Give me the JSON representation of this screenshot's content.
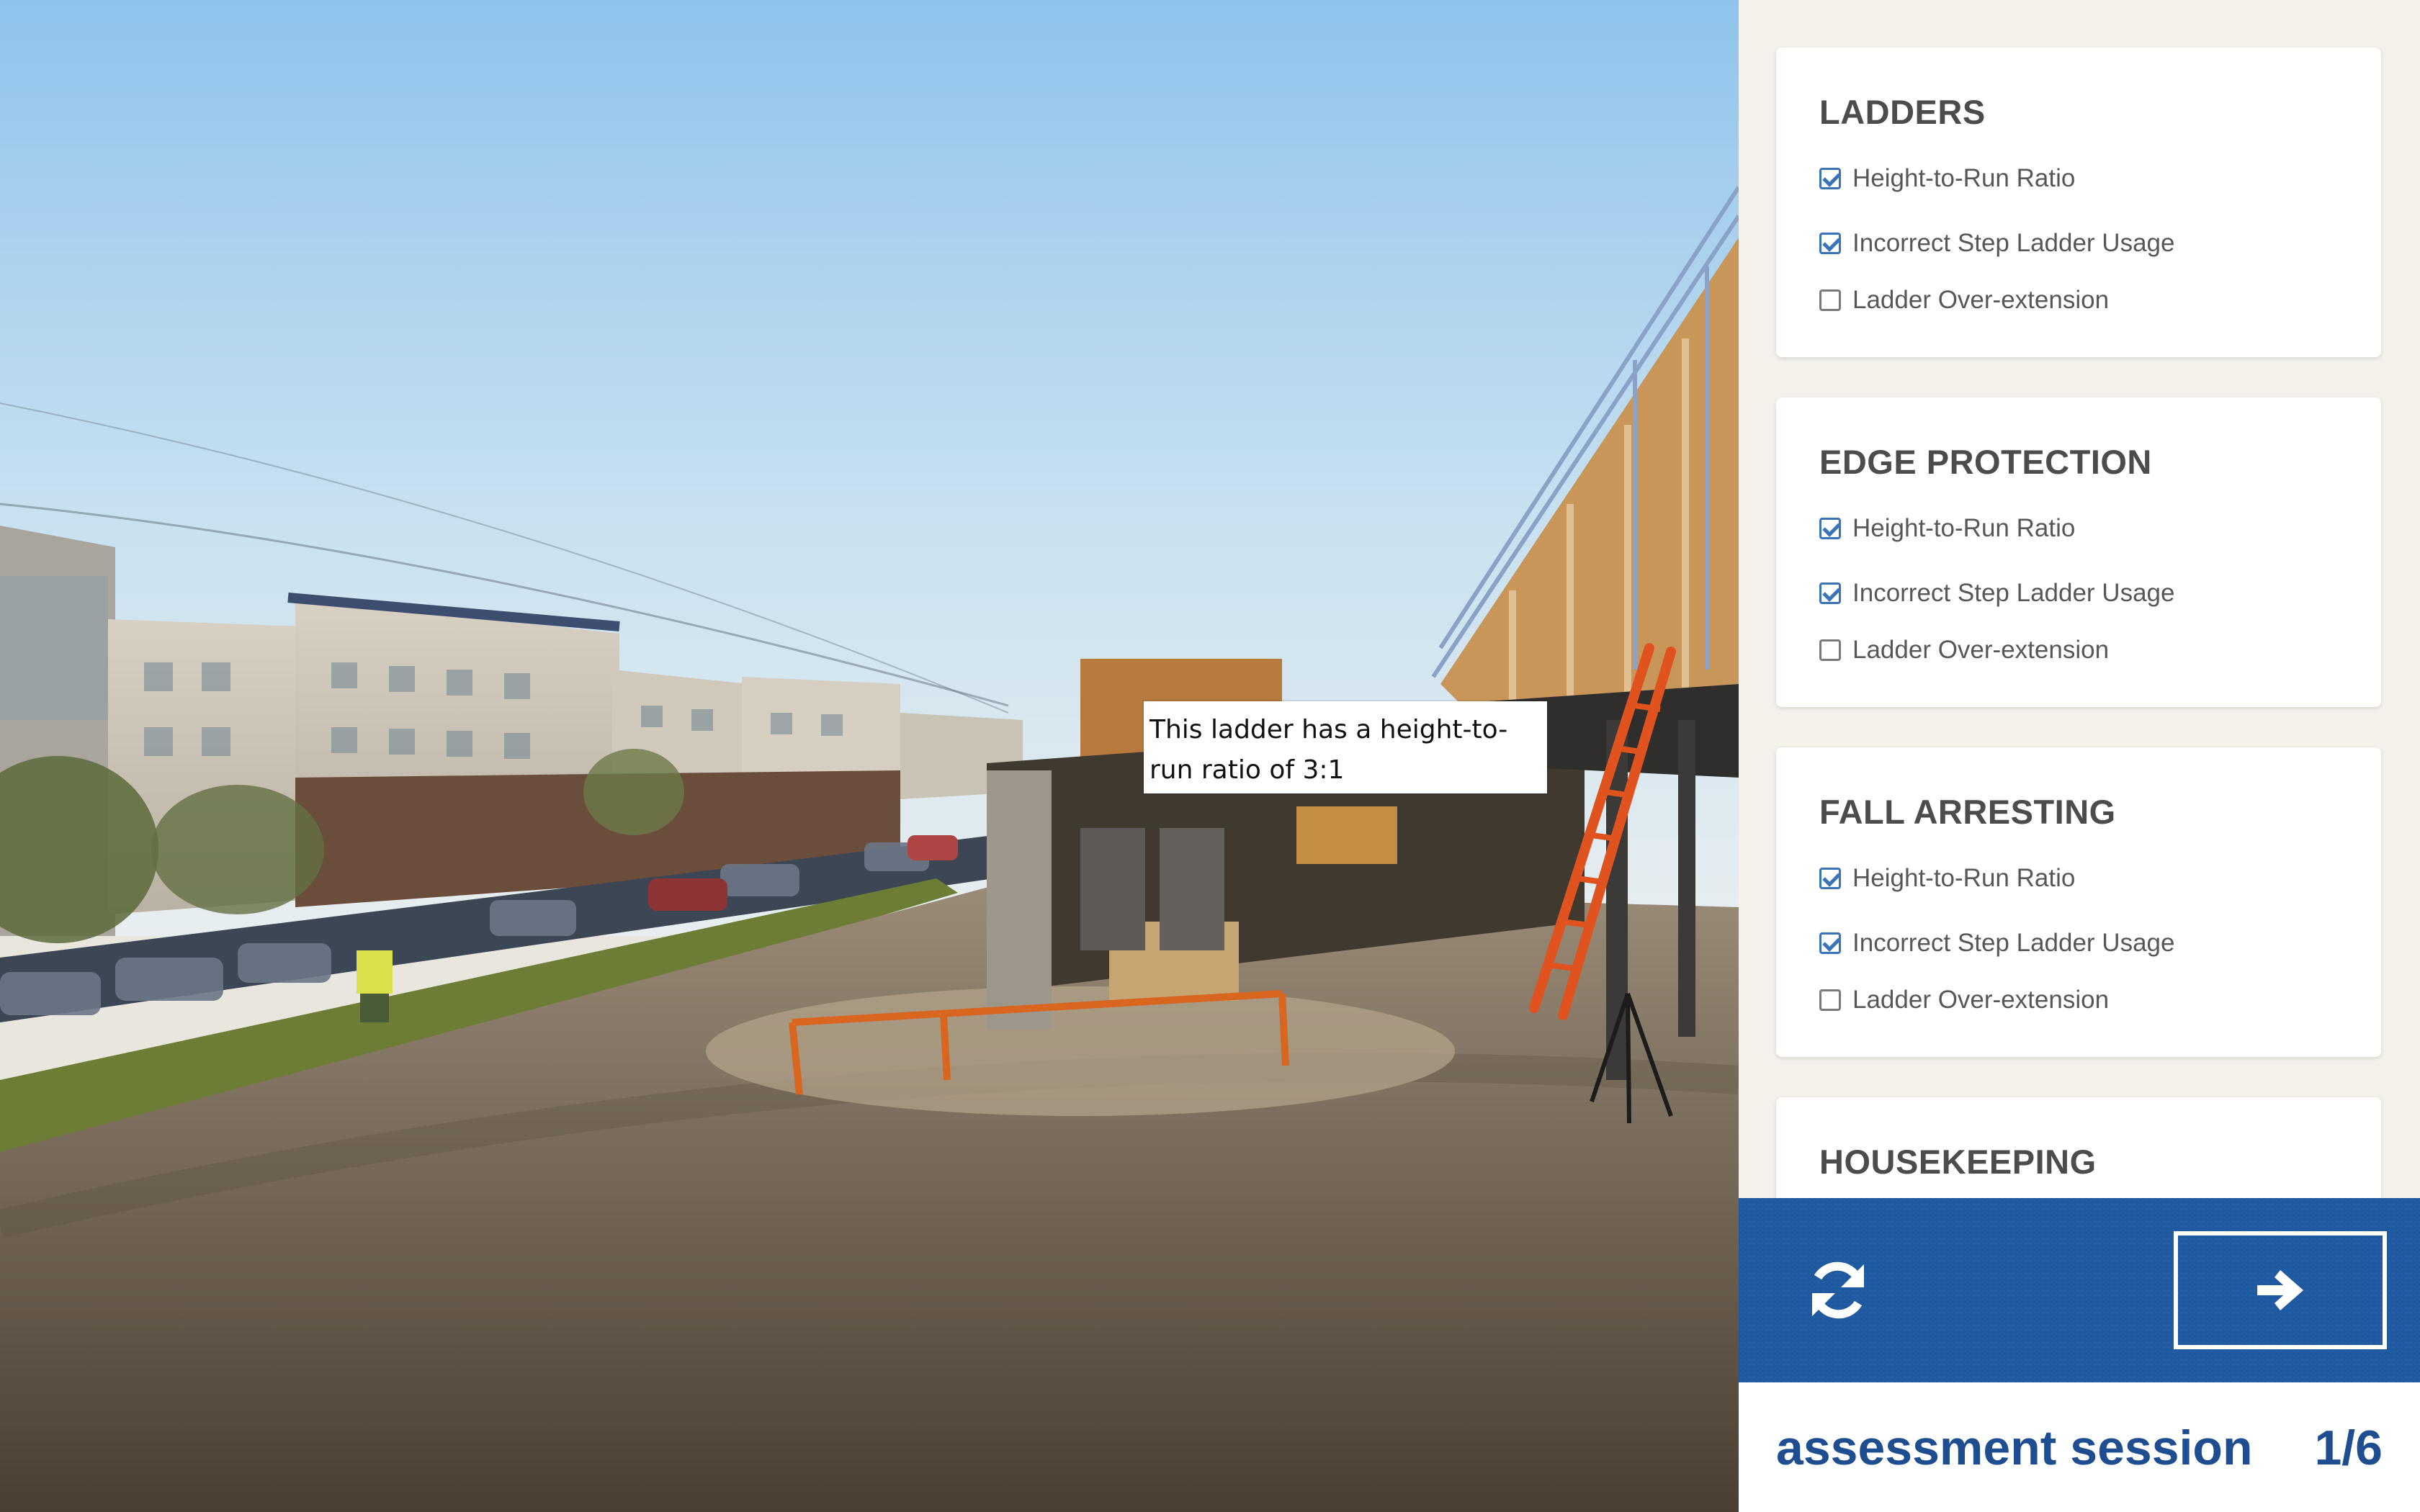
{
  "scene": {
    "tooltip": "This ladder has a height-to-run ratio of 3:1"
  },
  "sections": [
    {
      "title": "LADDERS",
      "items": [
        {
          "label": "Height-to-Run Ratio",
          "checked": true
        },
        {
          "label": "Incorrect Step Ladder Usage",
          "checked": true
        },
        {
          "label": "Ladder Over-extension",
          "checked": false
        }
      ]
    },
    {
      "title": "EDGE PROTECTION",
      "items": [
        {
          "label": "Height-to-Run Ratio",
          "checked": true
        },
        {
          "label": "Incorrect Step Ladder Usage",
          "checked": true
        },
        {
          "label": "Ladder Over-extension",
          "checked": false
        }
      ]
    },
    {
      "title": "FALL ARRESTING",
      "items": [
        {
          "label": "Height-to-Run Ratio",
          "checked": true
        },
        {
          "label": "Incorrect Step Ladder Usage",
          "checked": true
        },
        {
          "label": "Ladder Over-extension",
          "checked": false
        }
      ]
    },
    {
      "title": "HOUSEKEEPING",
      "items": []
    }
  ],
  "controls": {
    "refresh_icon": "refresh-icon",
    "next_icon": "arrow-right-icon"
  },
  "footer": {
    "session_label": "assessment session",
    "counter": "1/6"
  },
  "colors": {
    "accent": "#1f5aa1",
    "checkbox": "#3a73b8",
    "panel_bg": "#f3f1ea"
  }
}
